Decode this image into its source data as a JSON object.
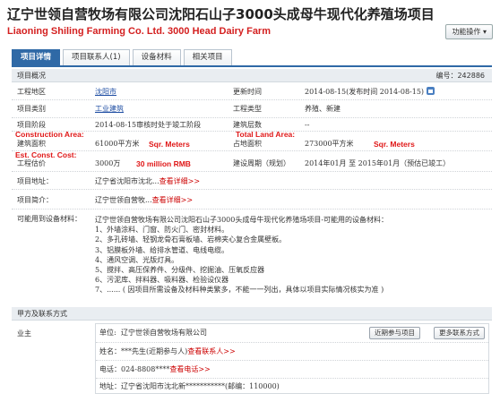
{
  "header": {
    "title_cn": "辽宁世领自营牧场有限公司沈阳石山子3000头成母牛现代化养殖场项目",
    "title_en": "Liaoning Shiling Farming Co. Ltd.  3000 Head Dairy Farm",
    "func_button": "功能操作 ▾"
  },
  "tabs": [
    {
      "label": "项目详情",
      "active": true
    },
    {
      "label": "项目联系人(1)",
      "active": false
    },
    {
      "label": "设备材料",
      "active": false
    },
    {
      "label": "相关项目",
      "active": false
    }
  ],
  "overview": {
    "label": "项目概况",
    "id_label": "编号：",
    "id_value": "242886"
  },
  "fields": {
    "region_label": "工程地区",
    "region_value": "沈阳市",
    "update_label": "更新时间",
    "update_value": "2014-08-15(发布时间 2014-08-15)",
    "category_label": "项目类别",
    "category_value": "工业建筑",
    "type_label": "工程类型",
    "type_value": "养殖、新建",
    "stage_label": "项目阶段",
    "stage_value": "2014-08-15审核时处于竣工阶段",
    "floors_label": "建筑层数",
    "floors_value": "--",
    "area_label": "建筑面积",
    "area_value": "61000平方米",
    "land_label": "占地面积",
    "land_value": "273000平方米",
    "cost_label": "工程估价",
    "cost_value": "3000万",
    "period_label": "建设周期（规划）",
    "period_value": "2014年01月 至 2015年01月（预估已竣工）",
    "address_label": "项目地址：",
    "address_value": "辽宁省沈阳市沈北...",
    "address_link": "查看详细>>",
    "intro_label": "项目简介：",
    "intro_value": "辽宁世领自营牧...",
    "intro_link": "查看详细>>",
    "equip_label": "可能用到设备材料："
  },
  "annotations": {
    "construction_area": "Construction Area:",
    "total_land_area": "Total Land Area:",
    "sqr_meters_1": "Sqr. Meters",
    "sqr_meters_2": "Sqr. Meters",
    "est_cost": "Est. Const. Cost:",
    "cost_rmb": "30 million RMB"
  },
  "equipment": [
    "辽宁世领自营牧场有限公司沈阳石山子3000头成母牛现代化养殖场项目-可能用的设备材料：",
    "1、外墙涂料、门窗、防火门、密封材料。",
    "2、多孔砖墙、轻钢龙骨石膏板墙、岩棉夹心复合金属壁板。",
    "3、铝膜板外墙、给排水管道、电线电缆。",
    "4、通风空调、光版灯具。",
    "5、搅拌、高压保养件、分级件、挖掘油、压氧反应器",
    "6、污泥库、拌料器、吸料器、检验设仪器",
    "7、...... ( 因项目所需设备及材料种类繁多，不能一一列出，具体以项目实际情况核实为准 )"
  ],
  "contact": {
    "section_label": "甲方及联系方式",
    "owner_label": "业主",
    "unit_label": "单位:",
    "unit_value": "辽宁世领自营牧场有限公司",
    "btn_recent": "近期参与项目",
    "btn_more": "更多联系方式",
    "name_label": "姓名：",
    "name_value": "***先生(近期参与人)",
    "name_link": "查看联系人>>",
    "phone_label": "电话：",
    "phone_value": "024-8808****",
    "phone_link": "查看电话>>",
    "addr_label": "地址：",
    "addr_value": "辽宁省沈阳市沈北新***********(邮编：110000)"
  }
}
